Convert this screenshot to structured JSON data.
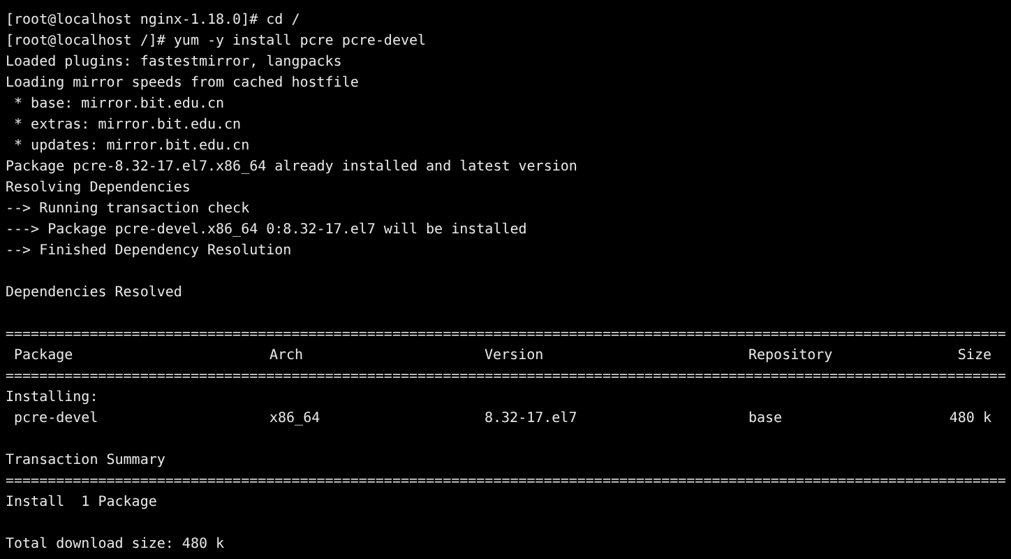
{
  "terminal": {
    "lines": [
      {
        "kind": "text",
        "text": "[root@localhost nginx-1.18.0]# cd /"
      },
      {
        "kind": "text",
        "text": "[root@localhost /]# yum -y install pcre pcre-devel"
      },
      {
        "kind": "text",
        "text": "Loaded plugins: fastestmirror, langpacks"
      },
      {
        "kind": "text",
        "text": "Loading mirror speeds from cached hostfile"
      },
      {
        "kind": "text",
        "text": " * base: mirror.bit.edu.cn"
      },
      {
        "kind": "text",
        "text": " * extras: mirror.bit.edu.cn"
      },
      {
        "kind": "text",
        "text": " * updates: mirror.bit.edu.cn"
      },
      {
        "kind": "text",
        "text": "Package pcre-8.32-17.el7.x86_64 already installed and latest version"
      },
      {
        "kind": "text",
        "text": "Resolving Dependencies"
      },
      {
        "kind": "text",
        "text": "--> Running transaction check"
      },
      {
        "kind": "text",
        "text": "---> Package pcre-devel.x86_64 0:8.32-17.el7 will be installed"
      },
      {
        "kind": "text",
        "text": "--> Finished Dependency Resolution"
      },
      {
        "kind": "blank"
      },
      {
        "kind": "text",
        "text": "Dependencies Resolved"
      },
      {
        "kind": "blank"
      },
      {
        "kind": "rule",
        "text": "======================================================================================================================="
      },
      {
        "kind": "row",
        "cells": [
          "Package",
          "Arch",
          "Version",
          "Repository",
          "Size"
        ]
      },
      {
        "kind": "rule",
        "text": "======================================================================================================================="
      },
      {
        "kind": "text",
        "text": "Installing:"
      },
      {
        "kind": "row",
        "cells": [
          "pcre-devel",
          "x86_64",
          "8.32-17.el7",
          "base",
          "480 k"
        ]
      },
      {
        "kind": "blank"
      },
      {
        "kind": "text",
        "text": "Transaction Summary"
      },
      {
        "kind": "rule",
        "text": "======================================================================================================================="
      },
      {
        "kind": "text",
        "text": "Install  1 Package"
      },
      {
        "kind": "blank"
      },
      {
        "kind": "text",
        "text": "Total download size: 480 k"
      }
    ]
  }
}
